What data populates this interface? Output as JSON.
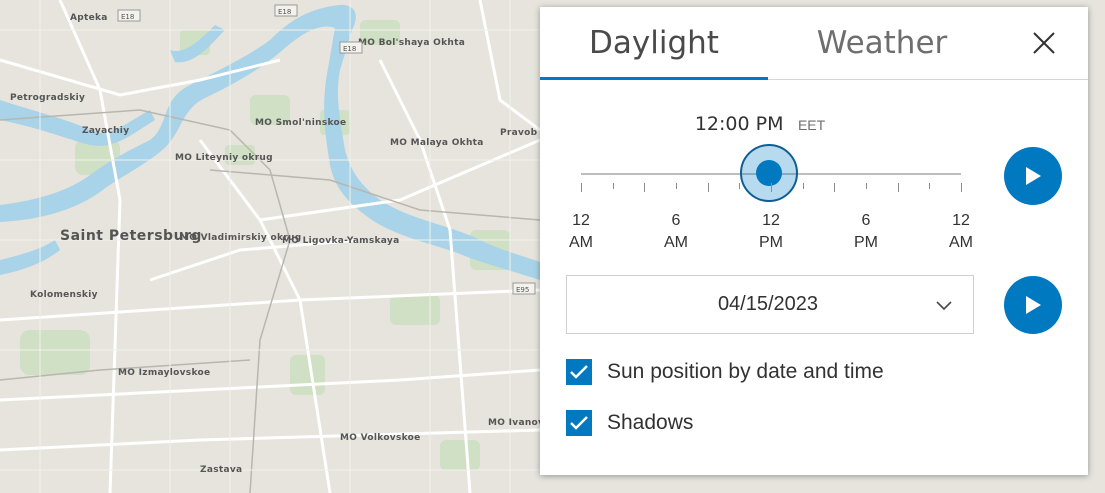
{
  "map": {
    "labels": [
      "Apteka",
      "Petrogradskiy",
      "Zayachiy",
      "MO Bol'shaya Okhta",
      "MO Smol'ninskoe",
      "MO Liteyniy okrug",
      "MO Malaya Okhta",
      "Pravob",
      "Saint Petersburg",
      "MO Vladimirskiy okrug",
      "MO Ligovka-Yamskaya",
      "Kolomenskiy",
      "MO Izmaylovskoe",
      "MO Volkovskoe",
      "Zastava",
      "MO Ivanovsk"
    ],
    "road_shields": [
      "E18",
      "E18",
      "E18",
      "E95"
    ]
  },
  "panel": {
    "tabs": [
      {
        "label": "Daylight",
        "active": true
      },
      {
        "label": "Weather",
        "active": false
      }
    ],
    "close_icon": "close-icon",
    "time": {
      "value": "12:00 PM",
      "timezone": "EET",
      "slider_fraction": 0.5,
      "tick_labels": [
        {
          "top": "12",
          "bottom": "AM"
        },
        {
          "top": "6",
          "bottom": "AM"
        },
        {
          "top": "12",
          "bottom": "PM"
        },
        {
          "top": "6",
          "bottom": "PM"
        },
        {
          "top": "12",
          "bottom": "AM"
        }
      ]
    },
    "date": {
      "value": "04/15/2023",
      "icon": "chevron-down-icon"
    },
    "play_icon": "play-icon",
    "checkboxes": [
      {
        "label": "Sun position by date and time",
        "checked": true
      },
      {
        "label": "Shadows",
        "checked": true
      }
    ]
  },
  "colors": {
    "accent": "#0079c1",
    "water": "#a8d3e8",
    "park": "#cfe0c4",
    "land": "#e6e4dd"
  }
}
